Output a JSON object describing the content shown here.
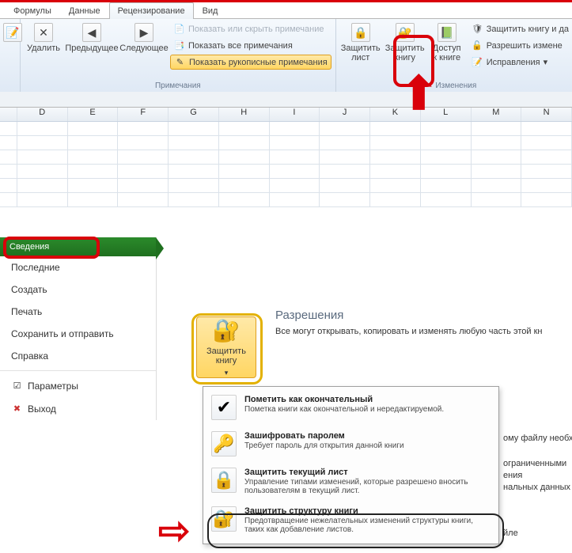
{
  "ribbon": {
    "tabs": [
      "Формулы",
      "Данные",
      "Рецензирование",
      "Вид"
    ],
    "active_tab_index": 2,
    "groups": {
      "comments": {
        "label": "Примечания",
        "new_comment": "...",
        "delete": "Удалить",
        "previous": "Предыдущее",
        "next": "Следующее",
        "show_hide": "Показать или скрыть примечание",
        "show_all": "Показать все примечания",
        "show_ink": "Показать рукописные примечания"
      },
      "changes": {
        "label": "Изменения",
        "protect_sheet": "Защитить лист",
        "protect_workbook": "Защитить книгу",
        "share_access": "Доступ к книге",
        "protect_share": "Защитить книгу и да",
        "allow_ranges": "Разрешить измене",
        "track_changes": "Исправления"
      }
    }
  },
  "columns": [
    "",
    "D",
    "E",
    "F",
    "G",
    "H",
    "I",
    "J",
    "K",
    "L",
    "M",
    "N"
  ],
  "backstage": {
    "active": "Сведения",
    "items": [
      "Последние",
      "Создать",
      "Печать",
      "Сохранить и отправить",
      "Справка"
    ],
    "params": "Параметры",
    "exit": "Выход"
  },
  "permissions": {
    "title": "Разрешения",
    "desc": "Все могут открывать, копировать и изменять любую часть этой кн",
    "protect_btn": "Защитить книгу",
    "side1": "ому файлу необход",
    "side2": "ограниченными",
    "side3": "ения",
    "side4": "нальных данных пр",
    "side5": "йле"
  },
  "dropdown": {
    "items": [
      {
        "title": "Пометить как окончательный",
        "desc": "Пометка книги как окончательной и нередактируемой."
      },
      {
        "title": "Зашифровать паролем",
        "desc": "Требует пароль для открытия данной книги"
      },
      {
        "title": "Защитить текущий лист",
        "desc": "Управление типами изменений, которые разрешено вносить пользователям в текущий лист."
      },
      {
        "title": "Защитить структуру книги",
        "desc": "Предотвращение нежелательных изменений структуры книги, таких как добавление листов."
      }
    ]
  }
}
